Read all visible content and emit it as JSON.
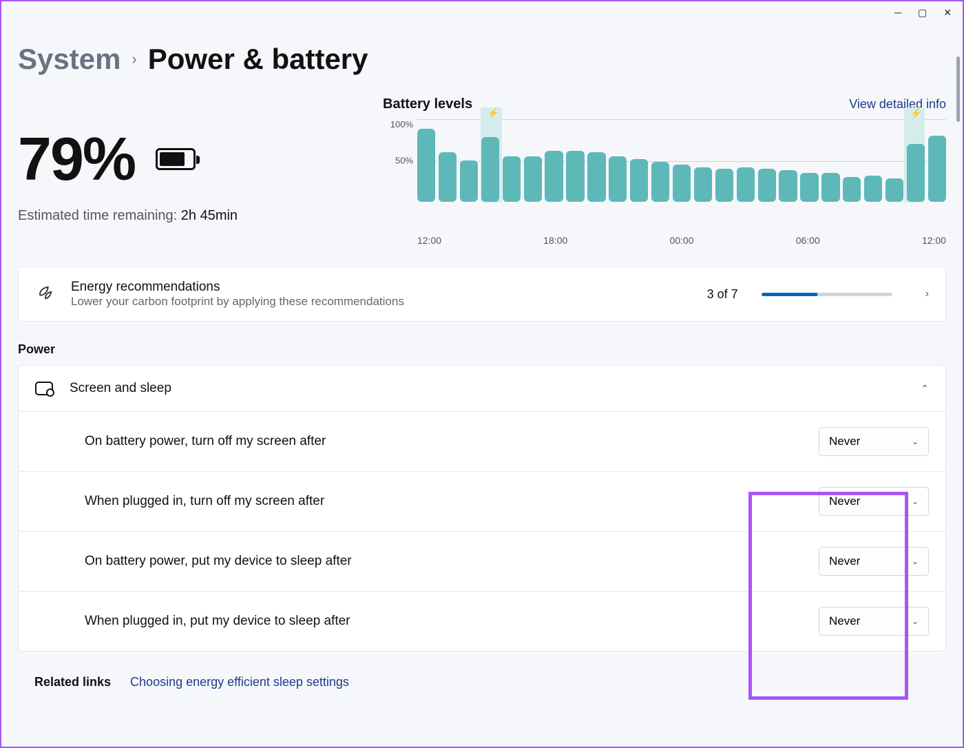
{
  "breadcrumb": {
    "parent": "System",
    "current": "Power & battery"
  },
  "battery": {
    "percent": "79%",
    "fill_pct": 79,
    "est_label": "Estimated time remaining:",
    "est_value": "2h 45min"
  },
  "chart": {
    "title": "Battery levels",
    "link": "View detailed info",
    "yticks": [
      "100%",
      "50%"
    ],
    "xticks": [
      "12:00",
      "18:00",
      "00:00",
      "06:00",
      "12:00"
    ]
  },
  "chart_data": {
    "type": "bar",
    "title": "Battery levels",
    "xlabel": "",
    "ylabel": "",
    "ylim": [
      0,
      100
    ],
    "categories": [
      "12:00",
      "13:00",
      "14:00",
      "15:00",
      "16:00",
      "17:00",
      "18:00",
      "19:00",
      "20:00",
      "21:00",
      "22:00",
      "23:00",
      "00:00",
      "01:00",
      "02:00",
      "03:00",
      "04:00",
      "05:00",
      "06:00",
      "07:00",
      "08:00",
      "09:00",
      "10:00",
      "11:00",
      "12:00"
    ],
    "values": [
      88,
      60,
      50,
      78,
      55,
      55,
      62,
      62,
      60,
      55,
      52,
      48,
      45,
      42,
      40,
      42,
      40,
      38,
      35,
      35,
      30,
      32,
      28,
      70,
      80
    ],
    "charging_markers": [
      3,
      23
    ]
  },
  "energy": {
    "title": "Energy recommendations",
    "sub": "Lower your carbon footprint by applying these recommendations",
    "count": "3 of 7",
    "progress_pct": 43
  },
  "power_section": "Power",
  "screen_sleep": {
    "title": "Screen and sleep",
    "rows": [
      {
        "label": "On battery power, turn off my screen after",
        "value": "Never"
      },
      {
        "label": "When plugged in, turn off my screen after",
        "value": "Never"
      },
      {
        "label": "On battery power, put my device to sleep after",
        "value": "Never"
      },
      {
        "label": "When plugged in, put my device to sleep after",
        "value": "Never"
      }
    ]
  },
  "related": {
    "label": "Related links",
    "link": "Choosing energy efficient sleep settings"
  }
}
